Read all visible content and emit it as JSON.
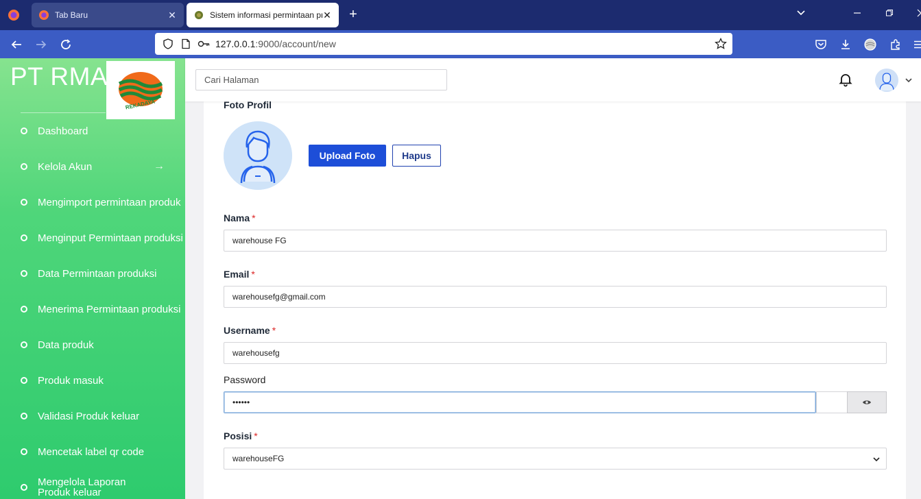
{
  "browser": {
    "tabs": [
      {
        "title": "Tab Baru",
        "active": false
      },
      {
        "title": "Sistem informasi permintaan pr",
        "active": true
      }
    ],
    "url_host": "127.0.0.1",
    "url_rest": ":9000/account/new"
  },
  "sidebar": {
    "brand": "PT RMA",
    "logo_text": "REKADAYA",
    "items": [
      {
        "label": "Dashboard"
      },
      {
        "label": "Kelola Akun",
        "arrow": "→"
      },
      {
        "label": "Mengimport permintaan produk"
      },
      {
        "label": "Menginput Permintaan produksi"
      },
      {
        "label": "Data Permintaan produksi"
      },
      {
        "label": "Menerima Permintaan produksi"
      },
      {
        "label": "Data produk"
      },
      {
        "label": "Produk masuk"
      },
      {
        "label": "Validasi Produk keluar"
      },
      {
        "label": "Mencetak label qr code"
      },
      {
        "label": "Mengelola Laporan Produk keluar"
      }
    ]
  },
  "header": {
    "search_placeholder": "Cari Halaman"
  },
  "form": {
    "photo_label": "Foto Profil",
    "upload_label": "Upload Foto",
    "delete_label": "Hapus",
    "required_mark": "*",
    "name_label": "Nama",
    "name_value": "warehouse FG",
    "email_label": "Email",
    "email_value": "warehousefg@gmail.com",
    "username_label": "Username",
    "username_value": "warehousefg",
    "password_label": "Password",
    "password_value": "••••••",
    "position_label": "Posisi",
    "position_value": "warehouseFG"
  },
  "colors": {
    "primary_button": "#1d4ed8",
    "sidebar_top": "#86e38f",
    "sidebar_bottom": "#2ecb6e",
    "required": "#dc2626"
  }
}
